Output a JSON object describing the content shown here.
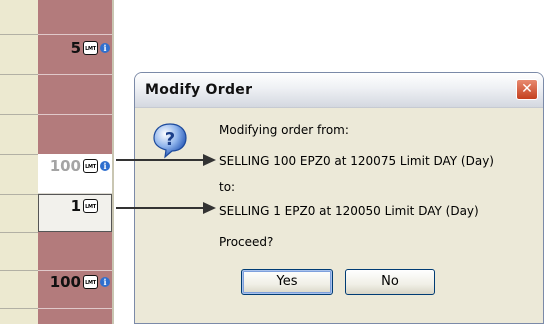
{
  "ladder": {
    "orders": [
      {
        "qty": "5",
        "badge": "LMT",
        "info": "i"
      },
      {
        "qty": "100",
        "badge": "LMT",
        "info": "i"
      },
      {
        "qty": "1",
        "badge": "LMT"
      },
      {
        "qty": "100",
        "badge": "LMT",
        "info": "i"
      }
    ]
  },
  "dialog": {
    "title": "Modify Order",
    "close": "✕",
    "line_from_label": "Modifying order from:",
    "line_from": "SELLING 100 EPZ0 at 120075 Limit DAY (Day)",
    "line_to_label": "to:",
    "line_to": "SELLING 1 EPZ0 at 120050 Limit DAY (Day)",
    "line_prompt": "Proceed?",
    "yes_label": "Yes",
    "no_label": "No"
  },
  "colors": {
    "ladder_left": "#ece9d0",
    "ladder_right": "#b37b7c",
    "dialog_bg": "#ece9d8",
    "close_red": "#c4401f"
  },
  "icons": [
    "question-icon",
    "info-icon",
    "lmt-badge-icon",
    "close-icon"
  ]
}
